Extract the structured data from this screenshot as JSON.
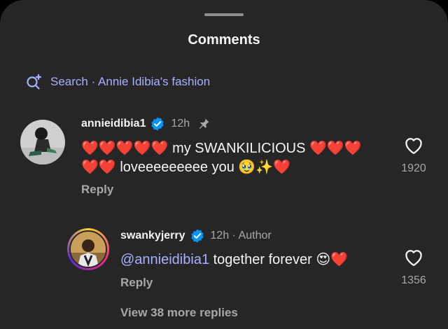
{
  "sheet": {
    "title": "Comments"
  },
  "search": {
    "text": "Search · Annie Idibia's fashion"
  },
  "comments": [
    {
      "username": "annieidibia1",
      "time": "12h",
      "line1": "❤️❤️❤️❤️❤️ my SWANKILICIOUS ❤️❤️❤️",
      "line2": "❤️❤️ loveeeeeeeee you 🥹✨❤️",
      "reply_label": "Reply",
      "likes": "1920"
    },
    {
      "username": "swankyjerry",
      "time": "12h · Author",
      "mention": "@annieidibia1",
      "text": " together forever 😍❤️",
      "reply_label": "Reply",
      "likes": "1356"
    }
  ],
  "view_more": "View 38 more replies",
  "colors": {
    "background": "#262626",
    "link": "#a9b0ff",
    "verified": "#0095f6",
    "muted": "#a8a8a8"
  }
}
